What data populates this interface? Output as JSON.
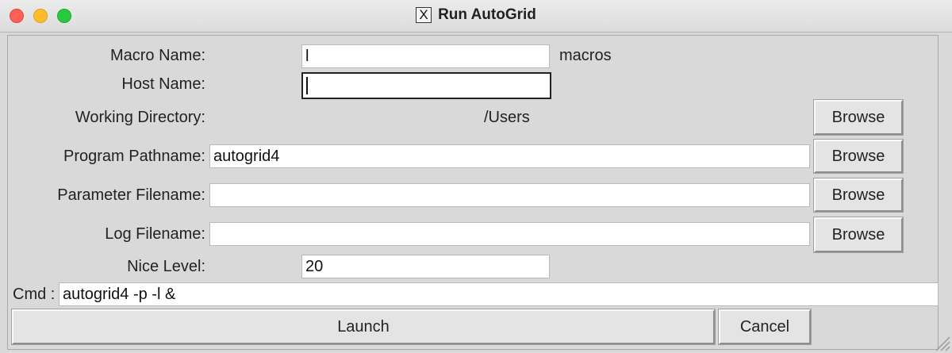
{
  "window": {
    "title": "Run AutoGrid",
    "title_icon": "X"
  },
  "form": {
    "macro_name": {
      "label": "Macro Name:",
      "value": "l",
      "suffix": "macros"
    },
    "host_name": {
      "label": "Host Name:",
      "value": ""
    },
    "working_directory": {
      "label": "Working Directory:",
      "value": "/Users",
      "browse": "Browse"
    },
    "program_pathname": {
      "label": "Program Pathname:",
      "value": "autogrid4",
      "browse": "Browse"
    },
    "parameter_filename": {
      "label": "Parameter Filename:",
      "value": "",
      "browse": "Browse"
    },
    "log_filename": {
      "label": "Log Filename:",
      "value": "",
      "browse": "Browse"
    },
    "nice_level": {
      "label": "Nice Level:",
      "value": "20"
    },
    "cmd": {
      "label": "Cmd :",
      "value": "autogrid4 -p  -l  &"
    }
  },
  "actions": {
    "launch": "Launch",
    "cancel": "Cancel"
  },
  "colors": {
    "close": "#fe5f57",
    "minimize": "#febc2e",
    "maximize": "#28c840",
    "background": "#d9d9d9"
  }
}
